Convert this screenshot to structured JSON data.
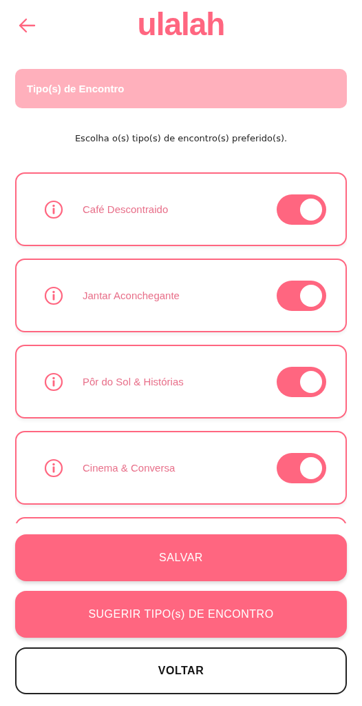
{
  "app_bar": {
    "logo": "ulalah"
  },
  "section_header": {
    "title": "Tipo(s) de Encontro"
  },
  "instruction": "Escolha o(s) tipo(s) de encontro(s) preferido(s).",
  "options": [
    {
      "label": "Café Descontraido",
      "on": true
    },
    {
      "label": "Jantar Aconchegante",
      "on": true
    },
    {
      "label": "Pôr do Sol & Histórias",
      "on": true
    },
    {
      "label": "Cinema & Conversa",
      "on": true
    }
  ],
  "buttons": [
    {
      "label": "SALVAR",
      "kind": "primary"
    },
    {
      "label": "SUGERIR TIPO(s) DE ENCONTRO",
      "kind": "primary"
    },
    {
      "label": "VOLTAR",
      "kind": "outline"
    }
  ]
}
